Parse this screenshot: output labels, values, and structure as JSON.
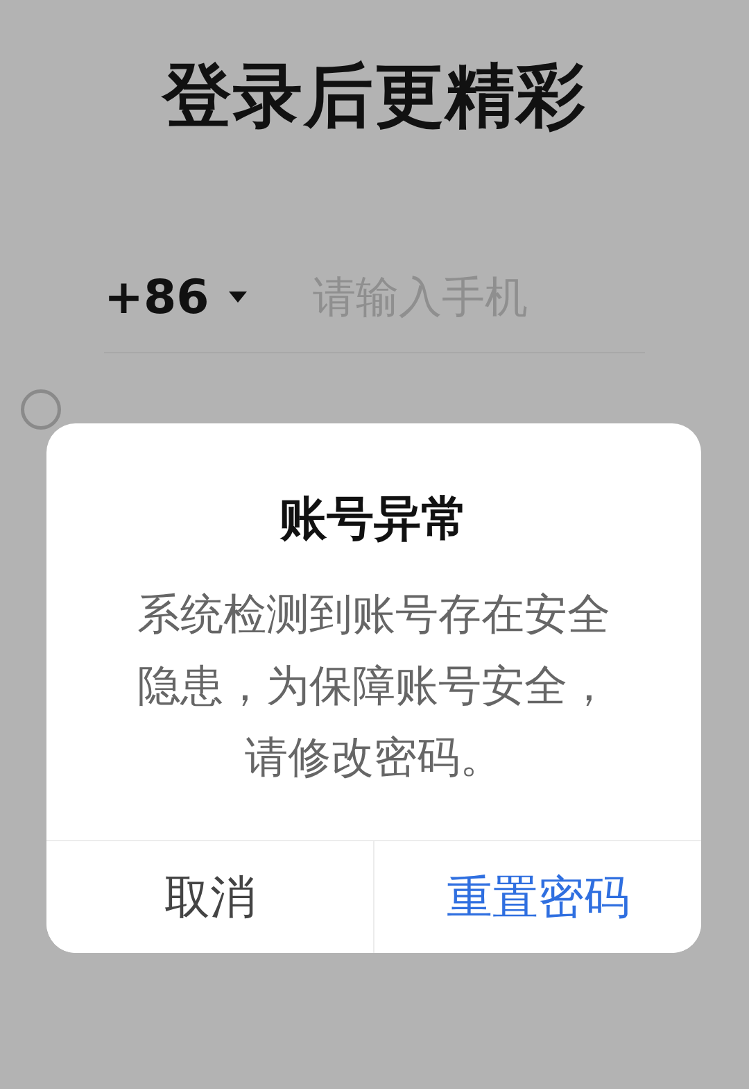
{
  "page_title": "登录后更精彩",
  "phone": {
    "country_code": "+86",
    "placeholder": "请输入手机"
  },
  "agreement": {
    "checked": false
  },
  "dialog": {
    "title": "账号异常",
    "message": "系统检测到账号存在安全隐患，为保障账号安全，请修改密码。",
    "buttons": [
      {
        "label": "取消",
        "kind": "cancel"
      },
      {
        "label": "重置密码",
        "kind": "primary"
      }
    ]
  }
}
